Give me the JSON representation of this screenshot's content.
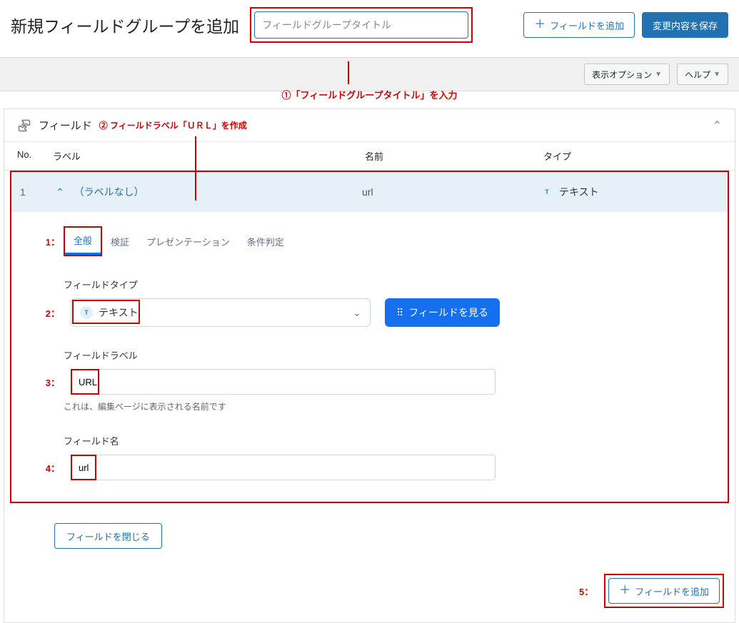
{
  "header": {
    "page_title": "新規フィールドグループを追加",
    "title_placeholder": "フィールドグループタイトル",
    "add_field_btn": "フィールドを追加",
    "save_btn": "変更内容を保存"
  },
  "secondary": {
    "display_options": "表示オプション",
    "help": "ヘルプ"
  },
  "annotations": {
    "step1_title": "①「フィールドグループタイトル」を入力",
    "step2_label": "② フィールドラベル「ＵＲＬ」を作成",
    "n1": "1：",
    "n2": "2：",
    "n3": "3：",
    "n4": "4：",
    "n5": "5："
  },
  "panel": {
    "title": "フィールド"
  },
  "columns": {
    "no": "No.",
    "label": "ラベル",
    "name": "名前",
    "type": "タイプ"
  },
  "field_row": {
    "no": "1",
    "label": "（ラベルなし）",
    "name": "url",
    "type_icon": "T",
    "type": "テキスト"
  },
  "tabs": {
    "general": "全般",
    "validation": "検証",
    "presentation": "プレゼンテーション",
    "conditional": "条件判定"
  },
  "form": {
    "field_type_label": "フィールドタイプ",
    "field_type_value": "テキスト",
    "field_type_icon": "T",
    "view_fields_btn": "フィールドを見る",
    "field_label_label": "フィールドラベル",
    "field_label_value": "URL",
    "field_label_help": "これは、編集ページに表示される名前です",
    "field_name_label": "フィールド名",
    "field_name_value": "url",
    "close_field_btn": "フィールドを閉じる"
  },
  "footer": {
    "add_field_btn": "フィールドを追加"
  }
}
